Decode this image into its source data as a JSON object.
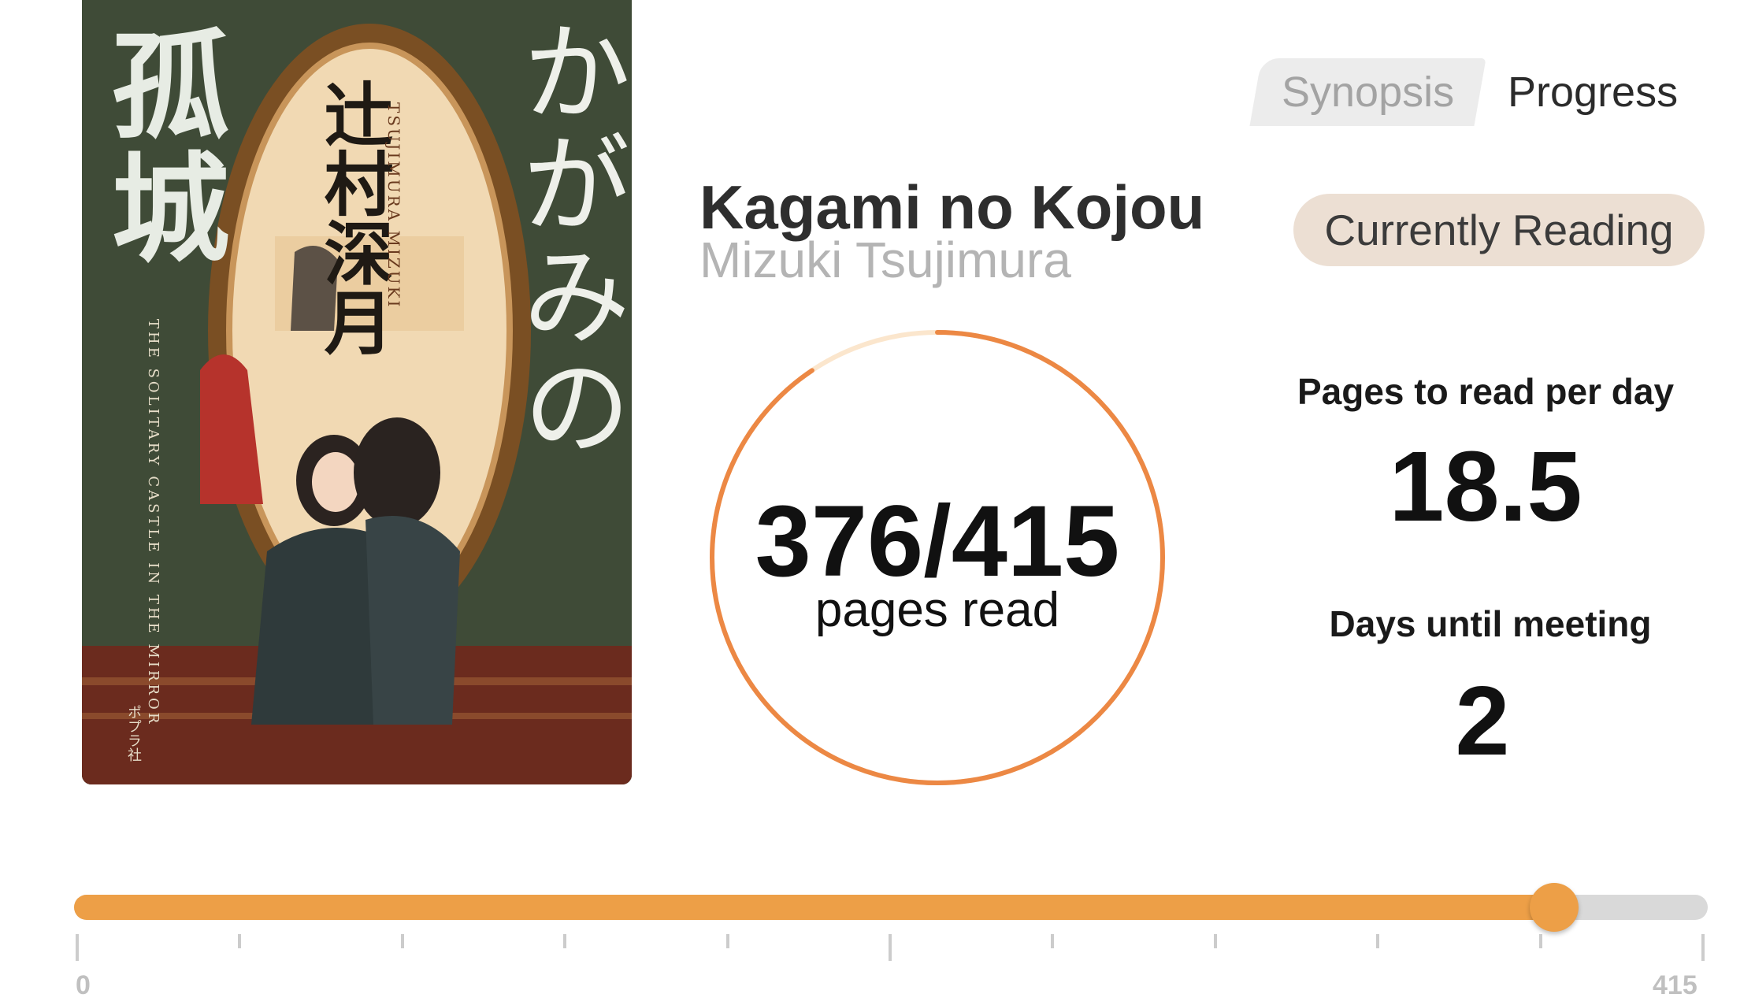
{
  "book": {
    "title": "Kagami no Kojou",
    "author": "Mizuki Tsujimura",
    "status": "Currently Reading",
    "cover": {
      "title_jp": "かがみの",
      "title_jp_2": "孤城",
      "author_jp": "辻村深月",
      "author_romaji": "TSUJIMURA MIZUKI",
      "subtitle_en": "THE SOLITARY CASTLE IN THE MIRROR",
      "publisher": "ポプラ社"
    }
  },
  "tabs": [
    {
      "label": "Synopsis",
      "active": false
    },
    {
      "label": "Progress",
      "active": true
    }
  ],
  "progress": {
    "pages_read": 376,
    "total_pages": 415,
    "display": "376/415",
    "caption": "pages read",
    "ring_color": "#ec8844",
    "ring_track_color": "#fbe6cd"
  },
  "stats": {
    "pages_per_day_label": "Pages to read per day",
    "pages_per_day_value": "18.5",
    "days_until_meeting_label": "Days until meeting",
    "days_until_meeting_value": "2"
  },
  "slider": {
    "min": 0,
    "max": 415,
    "value": 376,
    "min_label": "0",
    "max_label": "415",
    "fill_color": "#ed9f47",
    "track_color": "#d9d9d9"
  }
}
